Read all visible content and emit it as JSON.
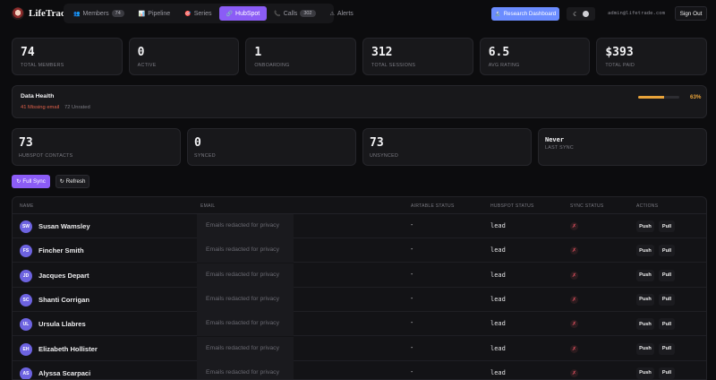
{
  "brand": {
    "name": "LifeTrade"
  },
  "nav": {
    "items": [
      {
        "label": "Members",
        "icon": "members-icon",
        "glyph": "👥",
        "badge": "74"
      },
      {
        "label": "Pipeline",
        "icon": "pipeline-icon",
        "glyph": "📊"
      },
      {
        "label": "Series",
        "icon": "series-icon",
        "glyph": "🎯"
      },
      {
        "label": "HubSpot",
        "icon": "hubspot-icon",
        "glyph": "🔗",
        "active": true
      },
      {
        "label": "Calls",
        "icon": "calls-icon",
        "glyph": "📞",
        "badge": "302"
      },
      {
        "label": "Alerts",
        "icon": "alerts-icon",
        "glyph": "⚠"
      }
    ]
  },
  "header": {
    "research_label": "Research Dashboard",
    "research_glyph": "🔬",
    "theme_glyph": "☾",
    "email": "admin@lifetrade.com",
    "signout_label": "Sign Out"
  },
  "stats": [
    {
      "value": "74",
      "label": "Total Members"
    },
    {
      "value": "0",
      "label": "Active"
    },
    {
      "value": "1",
      "label": "Onboarding"
    },
    {
      "value": "312",
      "label": "Total Sessions"
    },
    {
      "value": "6.5",
      "label": "Avg Rating"
    },
    {
      "value": "$393",
      "label": "Total Paid"
    }
  ],
  "health": {
    "title": "Data Health",
    "missing_email": "41 Missing email",
    "unrated": "72 Unrated",
    "percent_label": "63%",
    "percent_value": 0.63,
    "accent": "#e8a33a"
  },
  "hubspot_stats": [
    {
      "value": "73",
      "label": "HubSpot Contacts"
    },
    {
      "value": "0",
      "label": "Synced"
    },
    {
      "value": "73",
      "label": "Unsynced"
    },
    {
      "value": "Never",
      "label": "Last Sync"
    }
  ],
  "actions": {
    "full_sync_label": "Full Sync",
    "full_sync_glyph": "↻",
    "refresh_label": "Refresh",
    "refresh_glyph": "↻"
  },
  "table": {
    "columns": [
      "Name",
      "Email",
      "Airtable Status",
      "HubSpot Status",
      "Sync Status",
      "Actions"
    ],
    "email_redacted_text": "Emails redacted for privacy",
    "push_label": "Push",
    "pull_label": "Pull",
    "sync_glyph": "✗",
    "rows": [
      {
        "initials": "SW",
        "name": "Susan Wamsley",
        "airtable": "-",
        "hubspot": "lead"
      },
      {
        "initials": "FS",
        "name": "Fincher Smith",
        "airtable": "-",
        "hubspot": "lead"
      },
      {
        "initials": "JD",
        "name": "Jacques Depart",
        "airtable": "-",
        "hubspot": "lead"
      },
      {
        "initials": "SC",
        "name": "Shanti Corrigan",
        "airtable": "-",
        "hubspot": "lead"
      },
      {
        "initials": "UL",
        "name": "Ursula Llabres",
        "airtable": "-",
        "hubspot": "lead"
      },
      {
        "initials": "EH",
        "name": "Elizabeth Hollister",
        "airtable": "-",
        "hubspot": "lead"
      },
      {
        "initials": "AS",
        "name": "Alyssa Scarpaci",
        "airtable": "-",
        "hubspot": "lead"
      }
    ]
  },
  "colors": {
    "accent_purple": "#8b5cf6",
    "research_blue": "#6b8cff",
    "warning_red": "#e0604a",
    "avatar_purple": "#6d63e0"
  }
}
